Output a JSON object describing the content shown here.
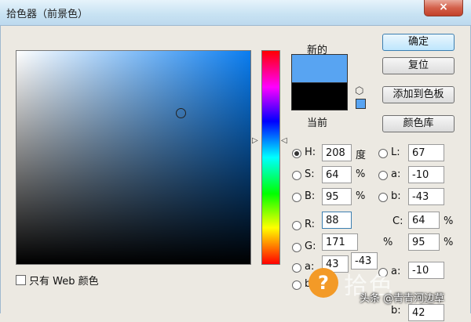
{
  "window": {
    "title": "拾色器（前景色）",
    "close_glyph": "×"
  },
  "labels": {
    "new": "新的",
    "current": "当前"
  },
  "colors": {
    "new_swatch": "#58a4f2",
    "current_swatch": "#000000",
    "picker_hue": "#0a7df0"
  },
  "buttons": {
    "ok": "确定",
    "reset": "复位",
    "add_to_swatches": "添加到色板",
    "color_libraries": "颜色库"
  },
  "web_only": {
    "label": "只有 Web 颜色",
    "checked": false
  },
  "hsb": {
    "h": {
      "label": "H:",
      "value": "208",
      "unit": "度",
      "selected": true
    },
    "s": {
      "label": "S:",
      "value": "64",
      "unit": "%"
    },
    "b": {
      "label": "B:",
      "value": "95",
      "unit": "%"
    }
  },
  "rgb": {
    "r": {
      "label": "R:",
      "value": "88"
    },
    "g": {
      "label": "G:",
      "value": "171"
    },
    "b": {
      "label": "a:",
      "value": "43",
      "extra": "-43"
    },
    "extra": {
      "label": "b:"
    }
  },
  "lab": {
    "l": {
      "label": "L:",
      "value": "67"
    },
    "a": {
      "label": "a:",
      "value": "-10"
    },
    "b": {
      "label": "b:",
      "value": "-43"
    },
    "a2": {
      "label": "a:",
      "value": "-10"
    },
    "b2": {
      "label": "b:",
      "value": "42"
    }
  },
  "cmyk": {
    "c": {
      "label": "C:",
      "value": "64",
      "unit": "%"
    },
    "pct_label": "%",
    "m": {
      "value": "95",
      "unit": "%"
    }
  },
  "watermark": {
    "badge": "?",
    "logo": "拾色",
    "text": "头条 @青青河边草"
  }
}
